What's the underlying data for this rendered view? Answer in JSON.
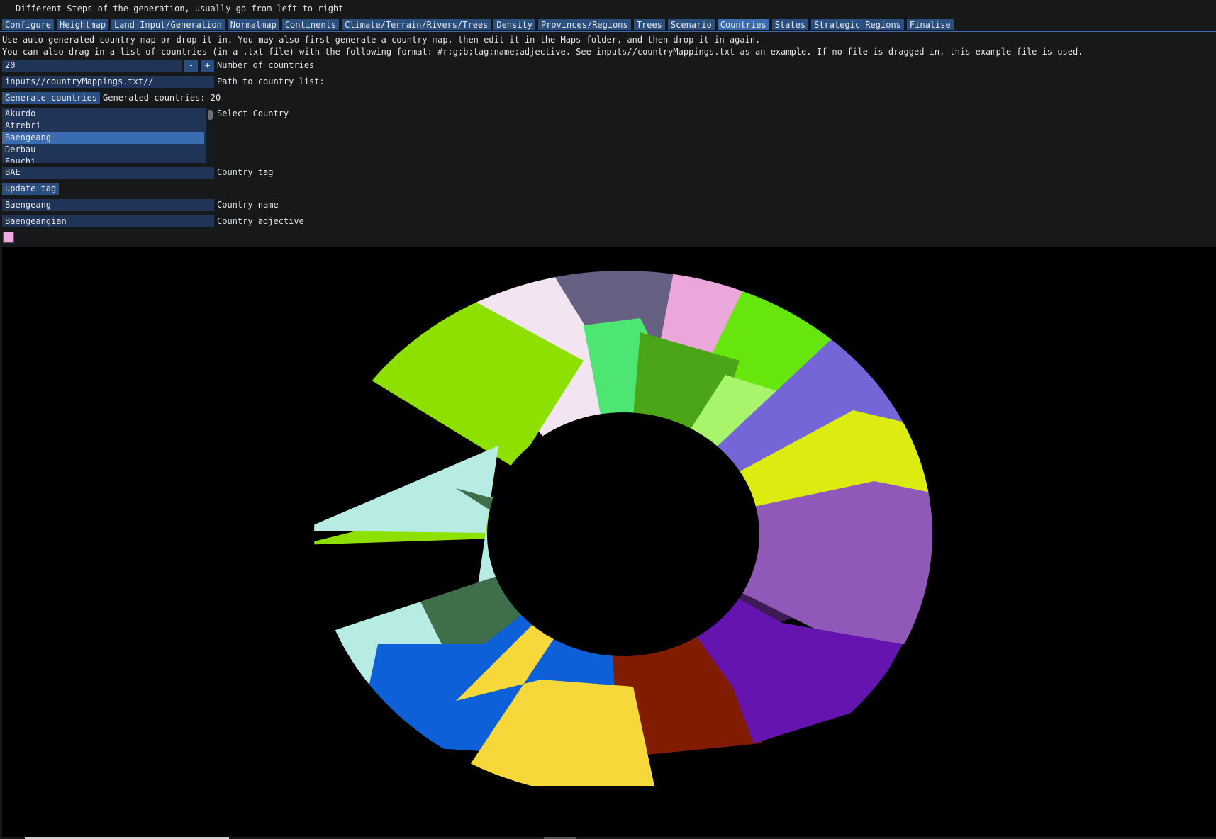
{
  "header": {
    "title": "Different Steps of the generation, usually go from left to right"
  },
  "tabs": [
    {
      "label": "Configure",
      "active": false
    },
    {
      "label": "Heightmap",
      "active": false
    },
    {
      "label": "Land Input/Generation",
      "active": false
    },
    {
      "label": "Normalmap",
      "active": false
    },
    {
      "label": "Continents",
      "active": false
    },
    {
      "label": "Climate/Terrain/Rivers/Trees",
      "active": false
    },
    {
      "label": "Density",
      "active": false
    },
    {
      "label": "Provinces/Regions",
      "active": false
    },
    {
      "label": "Trees",
      "active": false
    },
    {
      "label": "Scenario",
      "active": false
    },
    {
      "label": "Countries",
      "active": true
    },
    {
      "label": "States",
      "active": false
    },
    {
      "label": "Strategic Regions",
      "active": false
    },
    {
      "label": "Finalise",
      "active": false
    }
  ],
  "info": {
    "line1": "Use auto generated country map or drop it in. You may also first generate a country map, then edit it in the Maps folder, and then drop it in again.",
    "line2": "You can also drag in a list of countries (in a .txt file) with the following format: #r;g;b;tag;name;adjective. See inputs//countryMappings.txt as an example. If no file is dragged in, this example file is used."
  },
  "controls": {
    "num_countries": "20",
    "minus": "-",
    "plus": "+",
    "num_countries_label": "Number of countries",
    "path_value": "inputs//countryMappings.txt//",
    "path_label": "Path to country list:",
    "generate_button": "Generate countries",
    "generated_text": "Generated countries: 20",
    "select_label": "Select Country",
    "tag_value": "BAE",
    "tag_label": "Country tag",
    "update_tag_button": "update tag",
    "name_value": "Baengeang",
    "name_label": "Country name",
    "adjective_value": "Baengeangian",
    "adjective_label": "Country adjective",
    "swatch_color": "#f0a8e0"
  },
  "country_list": [
    "Akurdo",
    "Atrebri",
    "Baengeang",
    "Derbau",
    "Eouchi"
  ],
  "country_selected": "Baengeang",
  "map_colors": {
    "background": "#000000",
    "regions": [
      "#666082",
      "#f2e4f0",
      "#eba6da",
      "#66e60c",
      "#4ee672",
      "#4aa616",
      "#8ee000",
      "#a8f46a",
      "#c78a50",
      "#7466d6",
      "#dcec10",
      "#3e1a56",
      "#9058b8",
      "#b6ece4",
      "#3e6e4a",
      "#0e60d8",
      "#821c00",
      "#6614b0",
      "#f6d83a"
    ]
  }
}
